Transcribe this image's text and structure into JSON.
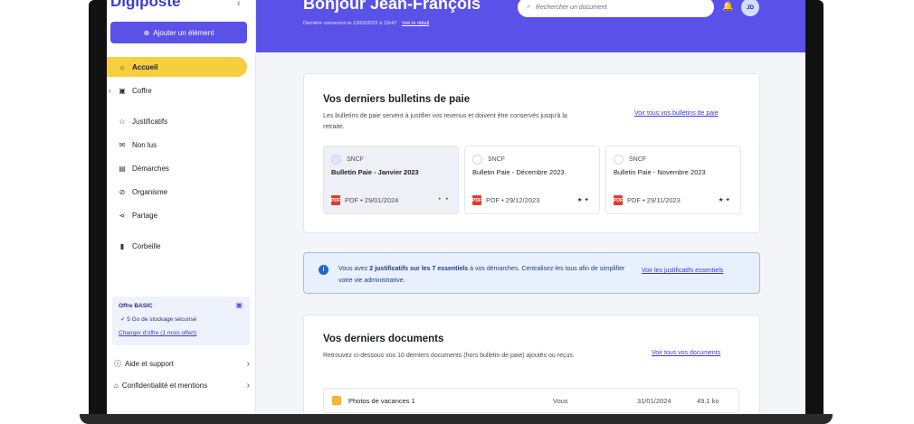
{
  "app": {
    "logo": "Digiposte"
  },
  "sidebar": {
    "add_button": "Ajouter un élément",
    "items": [
      {
        "label": "Accueil",
        "icon": "home-icon",
        "glyph": "⌂"
      },
      {
        "label": "Coffre",
        "icon": "vault-icon",
        "glyph": "▣"
      },
      {
        "label": "Justificatifs",
        "icon": "star-icon",
        "glyph": "☆"
      },
      {
        "label": "Non lus",
        "icon": "mail-icon",
        "glyph": "✉"
      },
      {
        "label": "Démarches",
        "icon": "document-icon",
        "glyph": "▤"
      },
      {
        "label": "Organisme",
        "icon": "compass-icon",
        "glyph": "⊘"
      },
      {
        "label": "Partage",
        "icon": "share-icon",
        "glyph": "⋖"
      },
      {
        "label": "Corbeille",
        "icon": "trash-icon",
        "glyph": "🗑"
      }
    ],
    "offer": {
      "title": "Offre BASIC",
      "storage": "5 Go de stockage sécurisé",
      "change_link": "Changer d'offre (1 mois offert)"
    },
    "footer": [
      {
        "label": "Aide et support",
        "glyph": "?"
      },
      {
        "label": "Confidentialité et mentions",
        "glyph": "⌂"
      }
    ]
  },
  "header": {
    "greeting": "Bonjour Jean-François",
    "last_login": "Dernière connexion le 13/03/2022 à 11h47",
    "last_login_link": "Voir le détail",
    "search_placeholder": "Rechercher un document",
    "avatar_initials": "JD"
  },
  "payslips": {
    "title": "Vos derniers bulletins de paie",
    "description": "Les bulletins de paie servent à justifier vos revenus et doivent être conservés jusqu'à la retraite.",
    "link": "Voir tous vos bulletins de paie",
    "items": [
      {
        "company": "SNCF",
        "title": "Bulletin Paie - Janvier 2023",
        "meta": "PDF • 29/01/2024"
      },
      {
        "company": "SNCF",
        "title": "Bulletin Paie - Décembre 2023",
        "meta": "PDF • 29/12/2023"
      },
      {
        "company": "SNCF",
        "title": "Bulletin Paie - Novembre 2023",
        "meta": "PDF • 29/11/2023"
      }
    ]
  },
  "banner": {
    "text_prefix": "Vous avez ",
    "text_bold": "2 justificatifs sur les 7 essentiels",
    "text_suffix": " à vos démarches. Centralisez-les tous afin de simplifier votre vie administrative.",
    "link": "Voir les justificatifs essentiels"
  },
  "documents": {
    "title": "Vos derniers documents",
    "description": "Retrouvez ci-dessous vos 10 derniers documents (hors bulletin de paie) ajoutés ou reçus.",
    "link": "Voir tous vos documents",
    "rows": [
      {
        "name": "Photos de vacances 1",
        "owner": "Vous",
        "date": "31/01/2024",
        "size": "49.1 ko"
      }
    ]
  },
  "colors": {
    "brand": "#5a51e8",
    "active": "#f7ce3e",
    "pdf": "#e23b30"
  }
}
